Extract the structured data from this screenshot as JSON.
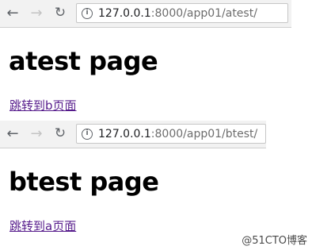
{
  "top": {
    "nav": {
      "back_icon": "back-arrow-icon",
      "forward_icon": "forward-arrow-icon",
      "reload_icon": "reload-icon"
    },
    "url": {
      "host": "127.0.0.1",
      "rest": ":8000/app01/atest/"
    },
    "heading": "atest page",
    "link_text": "跳转到b页面"
  },
  "bottom": {
    "nav": {
      "back_icon": "back-arrow-icon",
      "forward_icon": "forward-arrow-icon",
      "reload_icon": "reload-icon"
    },
    "url": {
      "host": "127.0.0.1",
      "rest": ":8000/app01/btest/"
    },
    "heading": "btest page",
    "link_text": "跳转到a页面"
  },
  "watermark": "@51CTO博客",
  "colors": {
    "link_visited": "#551a8b",
    "toolbar": "#f2f2f2"
  }
}
